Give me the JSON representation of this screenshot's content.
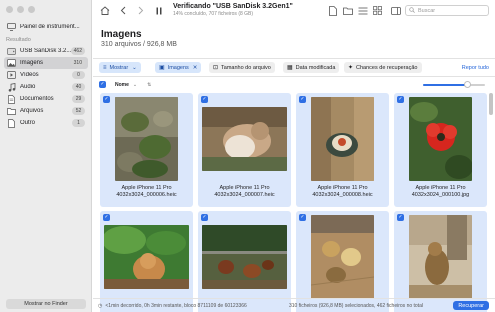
{
  "sidebar": {
    "top_item": {
      "label": "Painel de instrument...",
      "icon": "monitor-icon"
    },
    "section_label": "Resultado",
    "items": [
      {
        "label": "USB  SanDisk 3.2...",
        "count": "462",
        "icon": "drive-icon"
      },
      {
        "label": "Imagens",
        "count": "310",
        "icon": "image-icon",
        "active": true
      },
      {
        "label": "Vídeos",
        "count": "0",
        "icon": "video-icon"
      },
      {
        "label": "Áudio",
        "count": "40",
        "icon": "music-icon"
      },
      {
        "label": "Documentos",
        "count": "29",
        "icon": "document-icon"
      },
      {
        "label": "Arquivos",
        "count": "52",
        "icon": "folder-icon"
      },
      {
        "label": "Outro",
        "count": "1",
        "icon": "file-icon"
      }
    ],
    "finder_button": "Mostrar no Finder"
  },
  "header": {
    "title": "Verificando \"USB  SanDisk 3.2Gen1\"",
    "subtitle": "14% concluído, 707 ficheiros (8 GB)",
    "search_placeholder": "Buscar"
  },
  "main": {
    "heading": "Imagens",
    "subheading": "310 arquivos / 926,8 MB"
  },
  "filters": {
    "show": "Mostrar",
    "images": "Imagens",
    "file_size": "Tamanho do arquivo",
    "modified": "Data modificada",
    "recovery_chances": "Chances de recuperação",
    "reset": "Repor tudo"
  },
  "list": {
    "column_name": "Nome",
    "zoom_level": 0.72
  },
  "files": [
    {
      "device": "Apple iPhone 11 Pro",
      "name": "4032x3024_000006.heic"
    },
    {
      "device": "Apple iPhone 11 Pro",
      "name": "4032x3024_000007.heic"
    },
    {
      "device": "Apple iPhone 11 Pro",
      "name": "4032x3024_000008.heic"
    },
    {
      "device": "Apple iPhone 11 Pro",
      "name": "4032x3024_000100.jpg"
    },
    {
      "device": "",
      "name": ""
    },
    {
      "device": "",
      "name": ""
    },
    {
      "device": "",
      "name": ""
    },
    {
      "device": "",
      "name": ""
    }
  ],
  "status": {
    "progress": "<1min decorrido, 0h 3min restante, bloco 8711109 de 60123366",
    "selection": "310 ficheiros (926,8 MB) selecionados, 462 ficheiros no total",
    "recover_button": "Recuperar"
  },
  "colors": {
    "accent": "#2f6fe4",
    "selection_bg": "#dbe7fb"
  }
}
